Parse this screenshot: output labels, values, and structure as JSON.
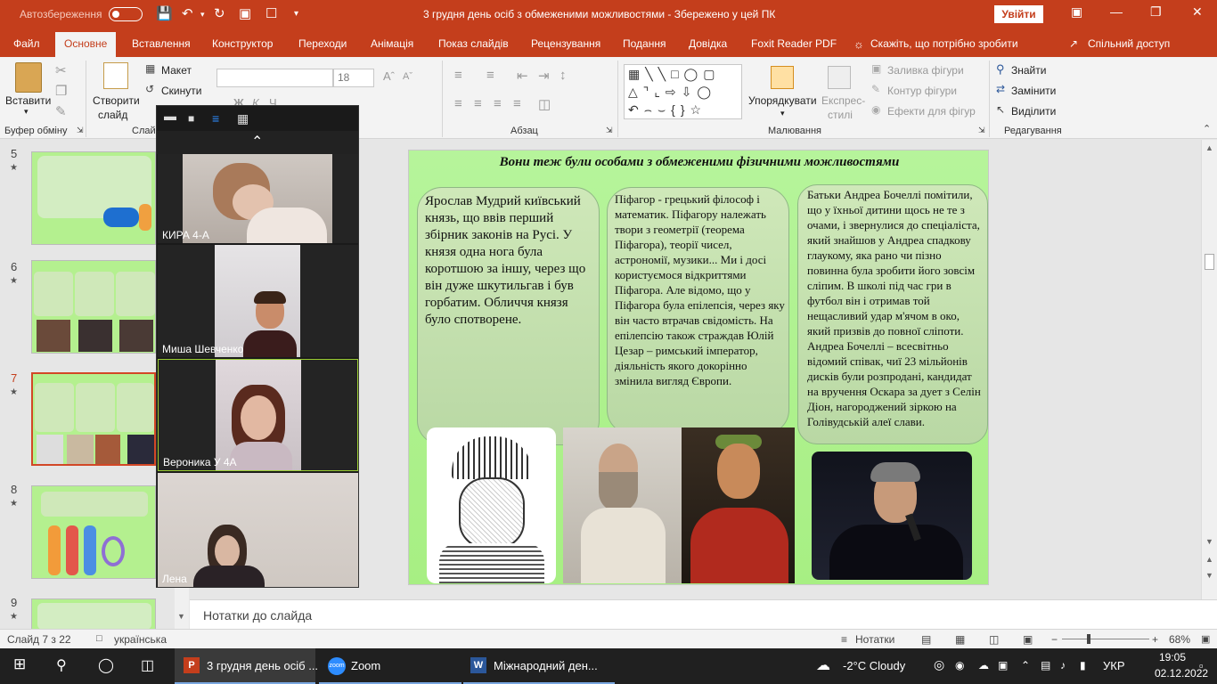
{
  "titlebar": {
    "autosave": "Автозбереження",
    "doc_title": "3 грудня день осіб з обмеженими можливостями  -  Збережено у цей ПК",
    "signin": "Увійти"
  },
  "tabs": [
    "Файл",
    "Основне",
    "Вставлення",
    "Конструктор",
    "Переходи",
    "Анімація",
    "Показ слайдів",
    "Рецензування",
    "Подання",
    "Довідка",
    "Foxit Reader PDF",
    "Скажіть, що потрібно зробити",
    "Спільний доступ"
  ],
  "ribbon": {
    "paste": "Вставити",
    "clipboard_group": "Буфер обміну",
    "new_slide_1": "Створити",
    "new_slide_2": "слайд",
    "slides_group": "Слай",
    "layout": "Макет",
    "reset": "Скинути",
    "font_size": "18",
    "paragraph_group": "Абзац",
    "arrange": "Упорядкувати",
    "quick_styles_1": "Експрес-",
    "quick_styles_2": "стилі",
    "shape_fill": "Заливка фігури",
    "shape_outline": "Контур фігури",
    "shape_effects": "Ефекти для фігур",
    "drawing_group": "Малювання",
    "find": "Знайти",
    "replace": "Замінити",
    "select": "Виділити",
    "editing_group": "Редагування"
  },
  "slides_panel": [
    {
      "num": "5",
      "star": "★"
    },
    {
      "num": "6",
      "star": "★"
    },
    {
      "num": "7",
      "star": "★",
      "selected": true
    },
    {
      "num": "8",
      "star": "★"
    },
    {
      "num": "9",
      "star": "★"
    }
  ],
  "slide": {
    "title": "Вони теж були особами  з обмеженими фізичними можливостями",
    "box1": "Ярослав Мудрий київський князь, що ввів перший збірник законів на Русі. У князя одна нога була коротшою за іншу, через що він дуже шкутильгав і був горбатим. Обличчя князя було спотворене.",
    "box2": "Піфагор - грецький філософ і математик. Піфагору належать твори з геометрії (теорема Піфагора), теорії чисел, астрономії, музики... Ми і досі користуємося відкриттями Піфагора. Але відомо, що у Піфагора була епілепсія, через яку він часто втрачав свідомість. На епілепсію також страждав Юлій Цезар – римський імператор, діяльність якого докорінно змінила вигляд Європи.",
    "box3": "Батьки Андреа Бочеллі помітили, що у їхньої дитини щось не те з очами, і звернулися до спеціаліста, який знайшов у Андреа спадкову глаукому, яка рано чи пізно повинна була зробити його зовсім сліпим. В школі під час гри в футбол він і отримав той нещасливий удар м'ячом в око, який призвів до повної сліпоти. Андреа Бочеллі – всесвітньо відомий співак, чиї 23 мільйонів дисків були розпродані, кандидат на вручення Оскара за дует з Селін Діон, нагороджений зіркою на Голівудській алеї слави."
  },
  "notes_placeholder": "Нотатки до слайда",
  "status": {
    "slide_count": "Слайд 7 з 22",
    "language": "українська",
    "notes": "Нотатки",
    "zoom": "68%"
  },
  "zoom_participants": [
    {
      "name": "КИРА 4-А"
    },
    {
      "name": "Миша Шевченко"
    },
    {
      "name": "Вероника У 4А"
    },
    {
      "name": "Лена"
    }
  ],
  "taskbar": {
    "app1": "3 грудня день осіб ...",
    "app2": "Zoom",
    "app3": "Міжнародний ден...",
    "weather": "-2°C  Cloudy",
    "lang": "УКР",
    "time": "19:05",
    "date": "02.12.2022"
  },
  "colors": {
    "accent": "#c43e1c",
    "slide_bg": "#b6f49b",
    "taskbar": "#202020"
  }
}
